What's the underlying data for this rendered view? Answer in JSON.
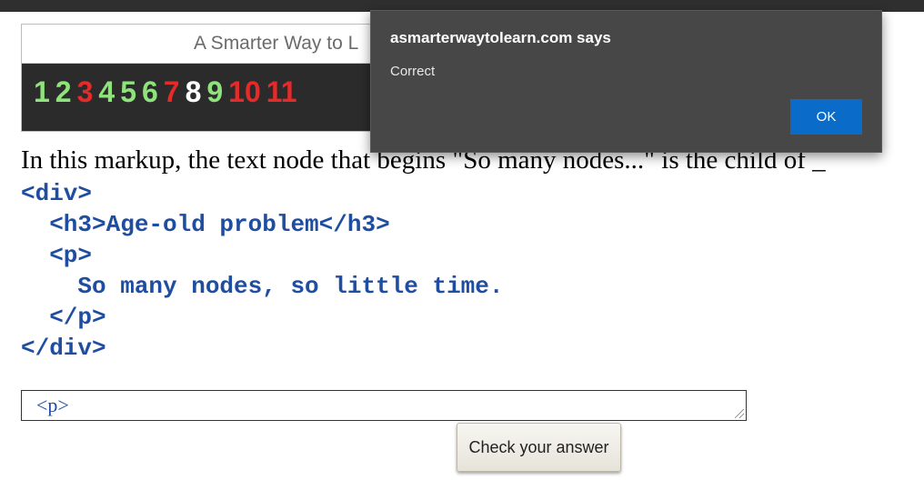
{
  "topbar": {
    "text": ""
  },
  "banner": {
    "title": "A Smarter Way to L",
    "numbers": [
      {
        "label": "1",
        "color": "#8ee37a"
      },
      {
        "label": "2",
        "color": "#8ee37a"
      },
      {
        "label": "3",
        "color": "#e52a2a"
      },
      {
        "label": "4",
        "color": "#8ee37a"
      },
      {
        "label": "5",
        "color": "#8ee37a"
      },
      {
        "label": "6",
        "color": "#8ee37a"
      },
      {
        "label": "7",
        "color": "#e52a2a"
      },
      {
        "label": "8",
        "color": "#ffffff"
      },
      {
        "label": "9",
        "color": "#8ee37a"
      },
      {
        "label": "10",
        "color": "#e52a2a"
      },
      {
        "label": "11",
        "color": "#e52a2a"
      }
    ]
  },
  "question": {
    "text": "In this markup, the text node that begins \"So many nodes...\" is the child of _"
  },
  "code": {
    "lines": [
      "<div>",
      "  <h3>Age-old problem</h3>",
      "  <p>",
      "    So many nodes, so little time.",
      "  </p>",
      "</div>"
    ]
  },
  "answer": {
    "value": "<p>"
  },
  "check_button": {
    "label": "Check your answer"
  },
  "dialog": {
    "title": "asmarterwaytolearn.com says",
    "message": "Correct",
    "ok_label": "OK"
  }
}
